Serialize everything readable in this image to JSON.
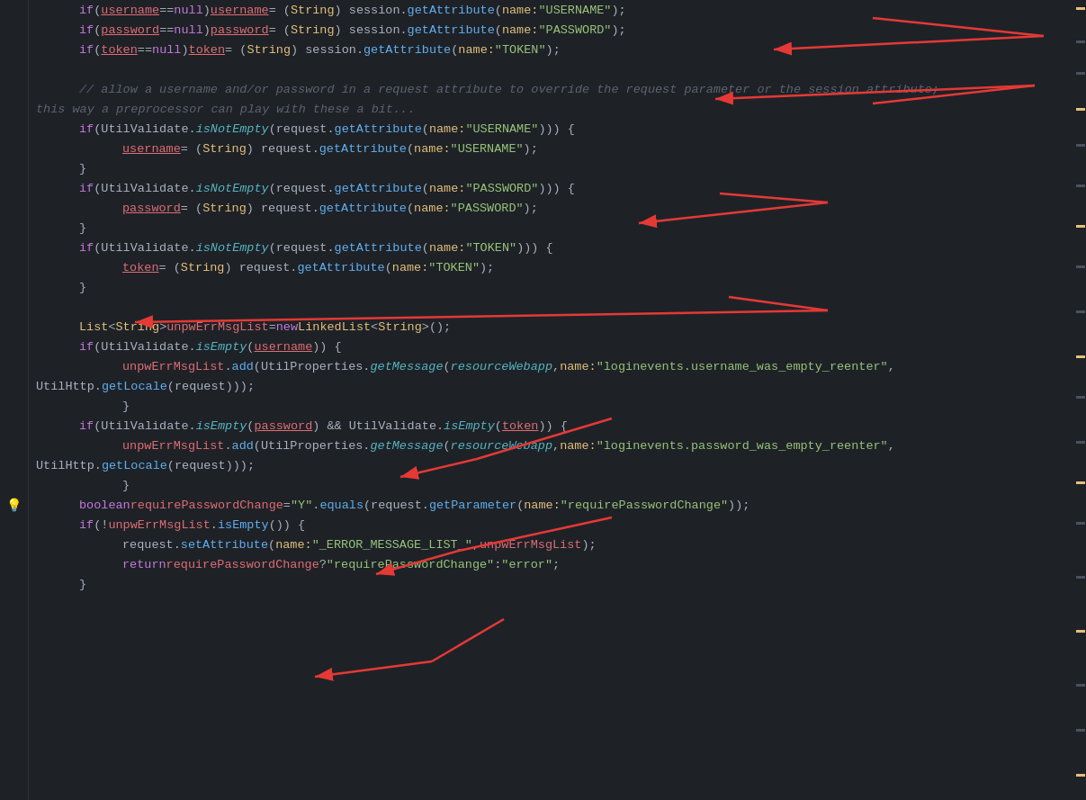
{
  "lines": [
    {
      "gutter": "",
      "indent": 1,
      "tokens": [
        {
          "t": "kw",
          "v": "if"
        },
        {
          "t": "punc",
          "v": " ("
        },
        {
          "t": "var-underline",
          "v": "username"
        },
        {
          "t": "punc",
          "v": " == "
        },
        {
          "t": "kw",
          "v": "null"
        },
        {
          "t": "punc",
          "v": ") "
        },
        {
          "t": "var-underline",
          "v": "username"
        },
        {
          "t": "punc",
          "v": " = ("
        },
        {
          "t": "type",
          "v": "String"
        },
        {
          "t": "punc",
          "v": ") session."
        },
        {
          "t": "fn",
          "v": "getAttribute"
        },
        {
          "t": "punc",
          "v": "( "
        },
        {
          "t": "named-arg",
          "v": "name:"
        },
        {
          "t": "punc",
          "v": " "
        },
        {
          "t": "str",
          "v": "\"USERNAME\""
        },
        {
          "t": "punc",
          "v": ");"
        }
      ]
    },
    {
      "gutter": "",
      "indent": 1,
      "tokens": [
        {
          "t": "kw",
          "v": "if"
        },
        {
          "t": "punc",
          "v": " ("
        },
        {
          "t": "var-underline",
          "v": "password"
        },
        {
          "t": "punc",
          "v": " == "
        },
        {
          "t": "kw",
          "v": "null"
        },
        {
          "t": "punc",
          "v": ") "
        },
        {
          "t": "var-underline",
          "v": "password"
        },
        {
          "t": "punc",
          "v": " = ("
        },
        {
          "t": "type",
          "v": "String"
        },
        {
          "t": "punc",
          "v": ") session."
        },
        {
          "t": "fn",
          "v": "getAttribute"
        },
        {
          "t": "punc",
          "v": "( "
        },
        {
          "t": "named-arg",
          "v": "name:"
        },
        {
          "t": "punc",
          "v": " "
        },
        {
          "t": "str",
          "v": "\"PASSWORD\""
        },
        {
          "t": "punc",
          "v": ");"
        }
      ]
    },
    {
      "gutter": "",
      "indent": 1,
      "tokens": [
        {
          "t": "kw",
          "v": "if"
        },
        {
          "t": "punc",
          "v": " ("
        },
        {
          "t": "var-underline",
          "v": "token"
        },
        {
          "t": "punc",
          "v": " == "
        },
        {
          "t": "kw",
          "v": "null"
        },
        {
          "t": "punc",
          "v": ") "
        },
        {
          "t": "var-underline",
          "v": "token"
        },
        {
          "t": "punc",
          "v": " = ("
        },
        {
          "t": "type",
          "v": "String"
        },
        {
          "t": "punc",
          "v": ") session."
        },
        {
          "t": "fn",
          "v": "getAttribute"
        },
        {
          "t": "punc",
          "v": "( "
        },
        {
          "t": "named-arg",
          "v": "name:"
        },
        {
          "t": "punc",
          "v": " "
        },
        {
          "t": "str",
          "v": "\"TOKEN\""
        },
        {
          "t": "punc",
          "v": ");"
        }
      ]
    },
    {
      "gutter": "",
      "blank": true
    },
    {
      "gutter": "",
      "indent": 1,
      "tokens": [
        {
          "t": "comment",
          "v": "// allow a username and/or password in a request attribute to override the request parameter or the session attribute;"
        }
      ]
    },
    {
      "gutter": "",
      "indent": 0,
      "tokens": [
        {
          "t": "comment",
          "v": "this way a preprocessor can play with these a bit..."
        }
      ]
    },
    {
      "gutter": "",
      "indent": 1,
      "tokens": [
        {
          "t": "kw",
          "v": "if"
        },
        {
          "t": "punc",
          "v": " (UtilValidate."
        },
        {
          "t": "method-italic",
          "v": "isNotEmpty"
        },
        {
          "t": "punc",
          "v": "(request."
        },
        {
          "t": "fn",
          "v": "getAttribute"
        },
        {
          "t": "punc",
          "v": "( "
        },
        {
          "t": "named-arg",
          "v": "name:"
        },
        {
          "t": "punc",
          "v": " "
        },
        {
          "t": "str",
          "v": "\"USERNAME\""
        },
        {
          "t": "punc",
          "v": "))) {"
        }
      ]
    },
    {
      "gutter": "",
      "indent": 2,
      "tokens": [
        {
          "t": "var-underline",
          "v": "username"
        },
        {
          "t": "punc",
          "v": " = ("
        },
        {
          "t": "type",
          "v": "String"
        },
        {
          "t": "punc",
          "v": ") request."
        },
        {
          "t": "fn",
          "v": "getAttribute"
        },
        {
          "t": "punc",
          "v": "( "
        },
        {
          "t": "named-arg",
          "v": "name:"
        },
        {
          "t": "punc",
          "v": " "
        },
        {
          "t": "str",
          "v": "\"USERNAME\""
        },
        {
          "t": "punc",
          "v": ");"
        }
      ]
    },
    {
      "gutter": "",
      "indent": 1,
      "tokens": [
        {
          "t": "punc",
          "v": "}"
        }
      ]
    },
    {
      "gutter": "",
      "indent": 1,
      "tokens": [
        {
          "t": "kw",
          "v": "if"
        },
        {
          "t": "punc",
          "v": " (UtilValidate."
        },
        {
          "t": "method-italic",
          "v": "isNotEmpty"
        },
        {
          "t": "punc",
          "v": "(request."
        },
        {
          "t": "fn",
          "v": "getAttribute"
        },
        {
          "t": "punc",
          "v": "( "
        },
        {
          "t": "named-arg",
          "v": "name:"
        },
        {
          "t": "punc",
          "v": " "
        },
        {
          "t": "str",
          "v": "\"PASSWORD\""
        },
        {
          "t": "punc",
          "v": "))) {"
        }
      ]
    },
    {
      "gutter": "",
      "indent": 2,
      "tokens": [
        {
          "t": "var-underline",
          "v": "password"
        },
        {
          "t": "punc",
          "v": " = ("
        },
        {
          "t": "type",
          "v": "String"
        },
        {
          "t": "punc",
          "v": ") request."
        },
        {
          "t": "fn",
          "v": "getAttribute"
        },
        {
          "t": "punc",
          "v": "( "
        },
        {
          "t": "named-arg",
          "v": "name:"
        },
        {
          "t": "punc",
          "v": " "
        },
        {
          "t": "str",
          "v": "\"PASSWORD\""
        },
        {
          "t": "punc",
          "v": ");"
        }
      ]
    },
    {
      "gutter": "",
      "indent": 1,
      "tokens": [
        {
          "t": "punc",
          "v": "}"
        }
      ]
    },
    {
      "gutter": "",
      "indent": 1,
      "tokens": [
        {
          "t": "kw",
          "v": "if"
        },
        {
          "t": "punc",
          "v": " (UtilValidate."
        },
        {
          "t": "method-italic",
          "v": "isNotEmpty"
        },
        {
          "t": "punc",
          "v": "(request."
        },
        {
          "t": "fn",
          "v": "getAttribute"
        },
        {
          "t": "punc",
          "v": "( "
        },
        {
          "t": "named-arg",
          "v": "name:"
        },
        {
          "t": "punc",
          "v": " "
        },
        {
          "t": "str",
          "v": "\"TOKEN\""
        },
        {
          "t": "punc",
          "v": "))) {"
        }
      ]
    },
    {
      "gutter": "",
      "indent": 2,
      "tokens": [
        {
          "t": "var-underline",
          "v": "token"
        },
        {
          "t": "punc",
          "v": " = ("
        },
        {
          "t": "type",
          "v": "String"
        },
        {
          "t": "punc",
          "v": ") request."
        },
        {
          "t": "fn",
          "v": "getAttribute"
        },
        {
          "t": "punc",
          "v": "( "
        },
        {
          "t": "named-arg",
          "v": "name:"
        },
        {
          "t": "punc",
          "v": " "
        },
        {
          "t": "str",
          "v": "\"TOKEN\""
        },
        {
          "t": "punc",
          "v": ");"
        }
      ]
    },
    {
      "gutter": "",
      "indent": 1,
      "tokens": [
        {
          "t": "punc",
          "v": "}"
        }
      ]
    },
    {
      "gutter": "",
      "blank": true
    },
    {
      "gutter": "",
      "indent": 1,
      "tokens": [
        {
          "t": "type",
          "v": "List"
        },
        {
          "t": "punc",
          "v": "<"
        },
        {
          "t": "type",
          "v": "String"
        },
        {
          "t": "punc",
          "v": "> "
        },
        {
          "t": "var",
          "v": "unpwErrMsgList"
        },
        {
          "t": "punc",
          "v": " = "
        },
        {
          "t": "kw",
          "v": "new"
        },
        {
          "t": "punc",
          "v": " "
        },
        {
          "t": "type",
          "v": "LinkedList"
        },
        {
          "t": "punc",
          "v": "<"
        },
        {
          "t": "type",
          "v": "String"
        },
        {
          "t": "punc",
          "v": ">();"
        }
      ]
    },
    {
      "gutter": "",
      "indent": 1,
      "tokens": [
        {
          "t": "kw",
          "v": "if"
        },
        {
          "t": "punc",
          "v": " (UtilValidate."
        },
        {
          "t": "method-italic",
          "v": "isEmpty"
        },
        {
          "t": "punc",
          "v": "("
        },
        {
          "t": "var-underline",
          "v": "username"
        },
        {
          "t": "punc",
          "v": ")) {"
        }
      ]
    },
    {
      "gutter": "",
      "indent": 2,
      "tokens": [
        {
          "t": "var",
          "v": "unpwErrMsgList"
        },
        {
          "t": "punc",
          "v": "."
        },
        {
          "t": "fn",
          "v": "add"
        },
        {
          "t": "punc",
          "v": "(UtilProperties."
        },
        {
          "t": "method-italic",
          "v": "getMessage"
        },
        {
          "t": "punc",
          "v": "("
        },
        {
          "t": "resource-var",
          "v": "resourceWebapp"
        },
        {
          "t": "punc",
          "v": ",  "
        },
        {
          "t": "named-arg",
          "v": "name:"
        },
        {
          "t": "punc",
          "v": " "
        },
        {
          "t": "str",
          "v": "\"loginevents.username_was_empty_reenter\""
        },
        {
          "t": "punc",
          "v": ","
        }
      ]
    },
    {
      "gutter": "",
      "indent": 0,
      "tokens": [
        {
          "t": "plain",
          "v": "        UtilHttp."
        },
        {
          "t": "fn",
          "v": "getLocale"
        },
        {
          "t": "punc",
          "v": "(request)));"
        }
      ]
    },
    {
      "gutter": "",
      "indent": 2,
      "tokens": [
        {
          "t": "punc",
          "v": "}"
        }
      ]
    },
    {
      "gutter": "",
      "indent": 1,
      "tokens": [
        {
          "t": "kw",
          "v": "if"
        },
        {
          "t": "punc",
          "v": " (UtilValidate."
        },
        {
          "t": "method-italic",
          "v": "isEmpty"
        },
        {
          "t": "punc",
          "v": "("
        },
        {
          "t": "var-underline",
          "v": "password"
        },
        {
          "t": "punc",
          "v": ") && UtilValidate."
        },
        {
          "t": "method-italic",
          "v": "isEmpty"
        },
        {
          "t": "punc",
          "v": "("
        },
        {
          "t": "var-underline",
          "v": "token"
        },
        {
          "t": "punc",
          "v": ")) {"
        }
      ]
    },
    {
      "gutter": "",
      "indent": 2,
      "tokens": [
        {
          "t": "var",
          "v": "unpwErrMsgList"
        },
        {
          "t": "punc",
          "v": "."
        },
        {
          "t": "fn",
          "v": "add"
        },
        {
          "t": "punc",
          "v": "(UtilProperties."
        },
        {
          "t": "method-italic",
          "v": "getMessage"
        },
        {
          "t": "punc",
          "v": "("
        },
        {
          "t": "resource-var",
          "v": "resourceWebapp"
        },
        {
          "t": "punc",
          "v": ",  "
        },
        {
          "t": "named-arg",
          "v": "name:"
        },
        {
          "t": "punc",
          "v": " "
        },
        {
          "t": "str",
          "v": "\"loginevents.password_was_empty_reenter\""
        },
        {
          "t": "punc",
          "v": ","
        }
      ]
    },
    {
      "gutter": "",
      "indent": 0,
      "tokens": [
        {
          "t": "plain",
          "v": "        UtilHttp."
        },
        {
          "t": "fn",
          "v": "getLocale"
        },
        {
          "t": "punc",
          "v": "(request)));"
        }
      ]
    },
    {
      "gutter": "",
      "indent": 2,
      "tokens": [
        {
          "t": "punc",
          "v": "}"
        }
      ]
    },
    {
      "gutter": "bulb",
      "indent": 1,
      "tokens": [
        {
          "t": "kw",
          "v": "boolean"
        },
        {
          "t": "punc",
          "v": " "
        },
        {
          "t": "var",
          "v": "requirePasswordChange"
        },
        {
          "t": "punc",
          "v": " = "
        },
        {
          "t": "str",
          "v": "\"Y\""
        },
        {
          "t": "punc",
          "v": "."
        },
        {
          "t": "fn",
          "v": "equals"
        },
        {
          "t": "punc",
          "v": "(request."
        },
        {
          "t": "fn",
          "v": "getParameter"
        },
        {
          "t": "punc",
          "v": "( "
        },
        {
          "t": "named-arg",
          "v": "name:"
        },
        {
          "t": "punc",
          "v": " "
        },
        {
          "t": "str",
          "v": "\"requirePasswordChange\""
        },
        {
          "t": "punc",
          "v": "));"
        }
      ]
    },
    {
      "gutter": "",
      "indent": 1,
      "tokens": [
        {
          "t": "kw",
          "v": "if"
        },
        {
          "t": "punc",
          "v": " (!"
        },
        {
          "t": "var",
          "v": "unpwErrMsgList"
        },
        {
          "t": "punc",
          "v": "."
        },
        {
          "t": "fn",
          "v": "isEmpty"
        },
        {
          "t": "punc",
          "v": "()) {"
        }
      ]
    },
    {
      "gutter": "",
      "indent": 2,
      "tokens": [
        {
          "t": "plain",
          "v": "request."
        },
        {
          "t": "fn",
          "v": "setAttribute"
        },
        {
          "t": "punc",
          "v": "( "
        },
        {
          "t": "named-arg",
          "v": "name:"
        },
        {
          "t": "punc",
          "v": " "
        },
        {
          "t": "str",
          "v": "\"_ERROR_MESSAGE_LIST_\""
        },
        {
          "t": "punc",
          "v": ", "
        },
        {
          "t": "var",
          "v": "unpwErrMsgList"
        },
        {
          "t": "punc",
          "v": ");"
        }
      ]
    },
    {
      "gutter": "",
      "indent": 2,
      "tokens": [
        {
          "t": "kw",
          "v": "return"
        },
        {
          "t": "punc",
          "v": " "
        },
        {
          "t": "var",
          "v": "requirePasswordChange"
        },
        {
          "t": "punc",
          "v": " ? "
        },
        {
          "t": "str",
          "v": "\"requirePasswordChange\""
        },
        {
          "t": "punc",
          "v": " : "
        },
        {
          "t": "str",
          "v": "\"error\""
        },
        {
          "t": "punc",
          "v": ";"
        }
      ]
    },
    {
      "gutter": "",
      "indent": 1,
      "tokens": [
        {
          "t": "punc",
          "v": "}"
        }
      ]
    }
  ],
  "scrollbar": {
    "marks": [
      22,
      44,
      55,
      70,
      115,
      155,
      200,
      245,
      290,
      340,
      390
    ]
  }
}
